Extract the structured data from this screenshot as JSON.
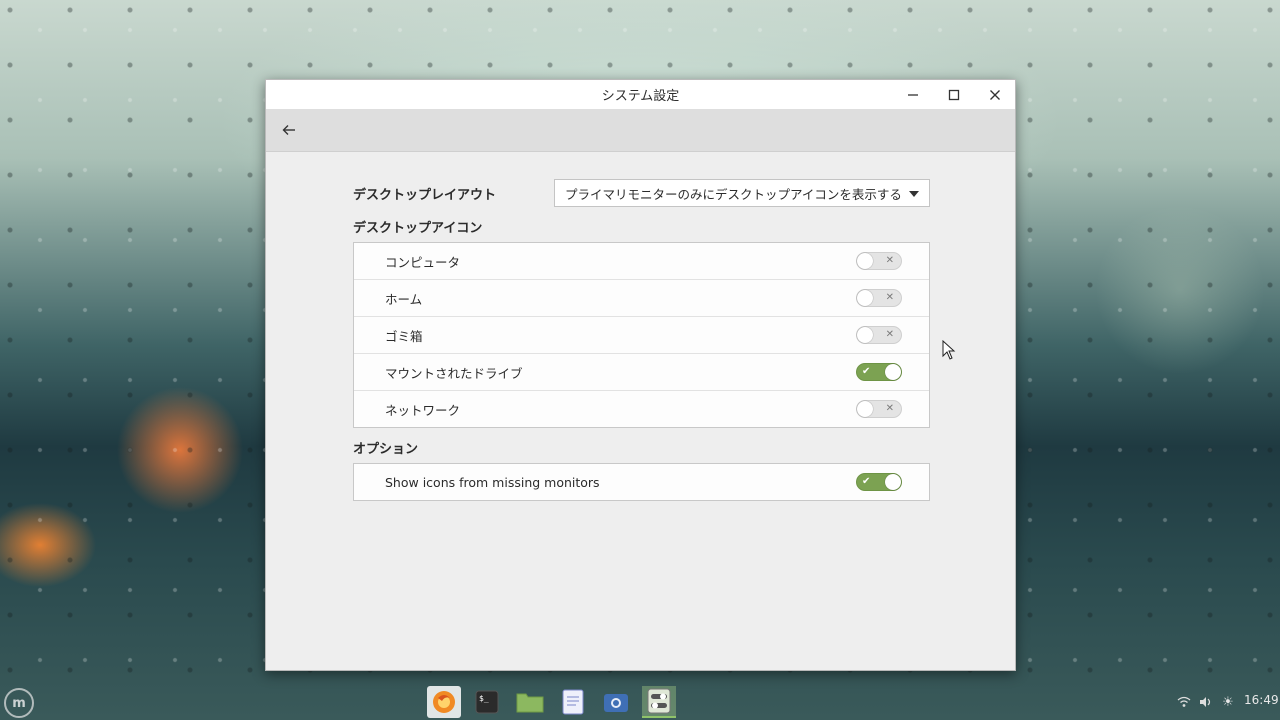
{
  "window": {
    "title": "システム設定"
  },
  "settings": {
    "layout_label": "デスクトップレイアウト",
    "layout_value": "プライマリモニターのみにデスクトップアイコンを表示する",
    "icons_section": "デスクトップアイコン",
    "icons": [
      {
        "label": "コンピュータ",
        "enabled": false
      },
      {
        "label": "ホーム",
        "enabled": false
      },
      {
        "label": "ゴミ箱",
        "enabled": false
      },
      {
        "label": "マウントされたドライブ",
        "enabled": true
      },
      {
        "label": "ネットワーク",
        "enabled": false
      }
    ],
    "options_section": "オプション",
    "options": [
      {
        "label": "Show icons from missing monitors",
        "enabled": true
      }
    ]
  },
  "panel": {
    "launchers": [
      "firefox-icon",
      "terminal-icon",
      "files-icon",
      "text-editor-icon",
      "screenshot-icon",
      "system-settings-icon"
    ],
    "clock": "16:49"
  },
  "colors": {
    "switch_on": "#7ca252",
    "switch_off": "#e4e4e4"
  }
}
